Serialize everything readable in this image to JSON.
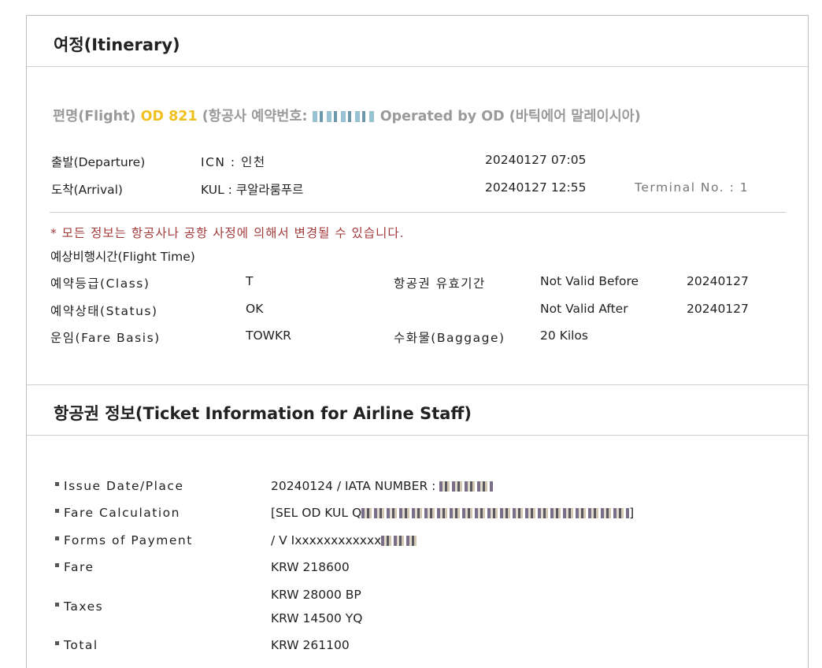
{
  "itinerary": {
    "title": "여정(Itinerary)",
    "flight": {
      "label": "편명(Flight)",
      "number": "OD 821",
      "booking_label": "(항공사 예약번호:",
      "operated": "Operated by OD (바틱에어 말레이시아)"
    },
    "departure": {
      "label": "출발(Departure)",
      "airport": "ICN : 인천",
      "datetime": "20240127 07:05"
    },
    "arrival": {
      "label": "도착(Arrival)",
      "airport": "KUL : 쿠알라룸푸르",
      "datetime": "20240127 12:55",
      "terminal": "Terminal No. : 1"
    },
    "notice": "* 모든 정보는 항공사나 공항 사정에 의해서 변경될 수 있습니다.",
    "flight_time_label": "예상비행시간(Flight Time)",
    "class": {
      "label": "예약등급(Class)",
      "value": "T"
    },
    "status": {
      "label": "예약상태(Status)",
      "value": "OK"
    },
    "fare_basis": {
      "label": "운임(Fare Basis)",
      "value": "TOWKR"
    },
    "validity_label": "항공권 유효기간",
    "not_valid_before": {
      "label": "Not Valid Before",
      "value": "20240127"
    },
    "not_valid_after": {
      "label": "Not Valid After",
      "value": "20240127"
    },
    "baggage": {
      "label": "수화물(Baggage)",
      "value": "20 Kilos"
    }
  },
  "ticket": {
    "title": "항공권 정보(Ticket Information for Airline Staff)",
    "rows": {
      "issue": {
        "label": "Issue Date/Place",
        "value": "20240124 / IATA NUMBER :"
      },
      "fare_calc": {
        "label": "Fare Calculation",
        "value_start": "[SEL OD KUL Q",
        "value_end": "]"
      },
      "payment": {
        "label": "Forms of Payment",
        "value": "/ V Ixxxxxxxxxxxx"
      },
      "fare": {
        "label": "Fare",
        "value": "KRW 218600"
      },
      "taxes": {
        "label": "Taxes",
        "value1": "KRW 28000 BP",
        "value2": "KRW 14500 YQ"
      },
      "total": {
        "label": "Total",
        "value": "KRW 261100"
      }
    }
  }
}
